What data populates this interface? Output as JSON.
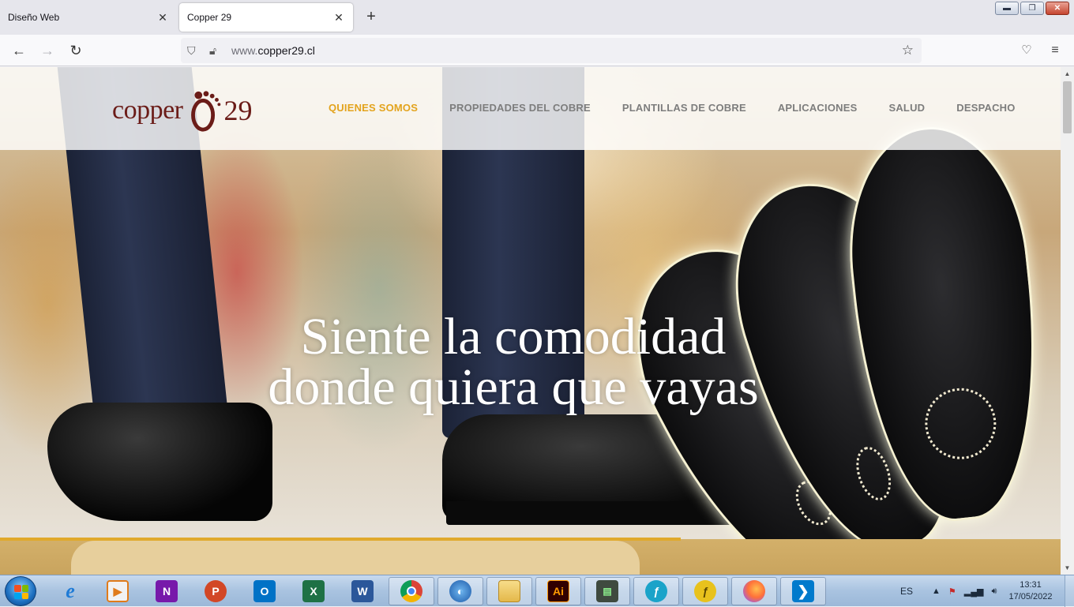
{
  "browser": {
    "tabs": [
      {
        "label": "Diseño Web",
        "active": false
      },
      {
        "label": "Copper 29",
        "active": true
      }
    ],
    "url_host_dim": "www.",
    "url_host": "copper29.cl"
  },
  "site": {
    "logo_word": "copper",
    "logo_num": "29",
    "nav": [
      {
        "label": "QUIENES SOMOS",
        "active": true
      },
      {
        "label": "PROPIEDADES DEL COBRE",
        "active": false
      },
      {
        "label": "PLANTILLAS DE COBRE",
        "active": false
      },
      {
        "label": "APLICACIONES",
        "active": false
      },
      {
        "label": "SALUD",
        "active": false
      },
      {
        "label": "DESPACHO",
        "active": false
      }
    ],
    "headline_line1": "Siente la comodidad",
    "headline_line2": "donde quiera que vayas",
    "colors": {
      "brand": "#6b1c18",
      "nav_active": "#e3a31d",
      "accent_line": "#e0a92b"
    }
  },
  "taskbar": {
    "apps": [
      "internet-explorer",
      "media-player",
      "onenote",
      "powerpoint",
      "outlook",
      "excel",
      "word",
      "chrome",
      "media-center",
      "file-explorer",
      "illustrator",
      "network-monitor",
      "app-blue",
      "app-yellow",
      "firefox",
      "vscode"
    ],
    "app_letters": {
      "onenote": "N",
      "powerpoint": "P",
      "outlook": "O",
      "excel": "X",
      "word": "W",
      "illustrator": "Ai"
    },
    "language": "ES",
    "time": "13:31",
    "date": "17/05/2022"
  }
}
